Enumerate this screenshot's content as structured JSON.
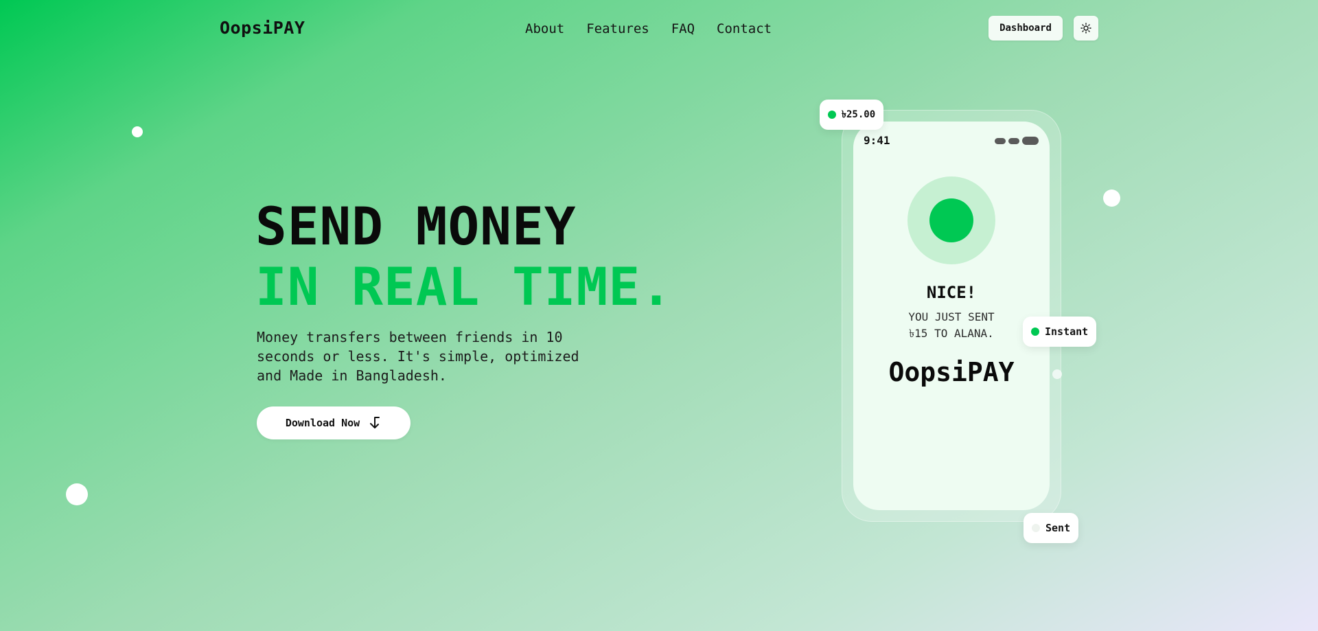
{
  "header": {
    "brand": "OopsiPAY",
    "nav": [
      "About",
      "Features",
      "FAQ",
      "Contact"
    ],
    "dashboard_label": "Dashboard",
    "theme_icon": "sun-icon"
  },
  "hero": {
    "headline_line1": "SEND MONEY",
    "headline_line2": "IN REAL TIME.",
    "subtitle": "Money transfers between friends in 10 seconds or less. It's simple, optimized and Made in Bangladesh.",
    "cta_label": "Download Now",
    "cta_icon": "arrow-down-left-icon"
  },
  "phone": {
    "time": "9:41",
    "title": "NICE!",
    "message_line1": "YOU JUST SENT",
    "message_line2": "৳15 TO ALANA.",
    "brand": "OopsiPAY"
  },
  "chips": {
    "amount": "৳25.00",
    "instant": "Instant",
    "sent": "Sent"
  },
  "colors": {
    "accent": "#00c853",
    "accent_light": "#c6f0d2",
    "phone_screen": "#eefcf2"
  }
}
